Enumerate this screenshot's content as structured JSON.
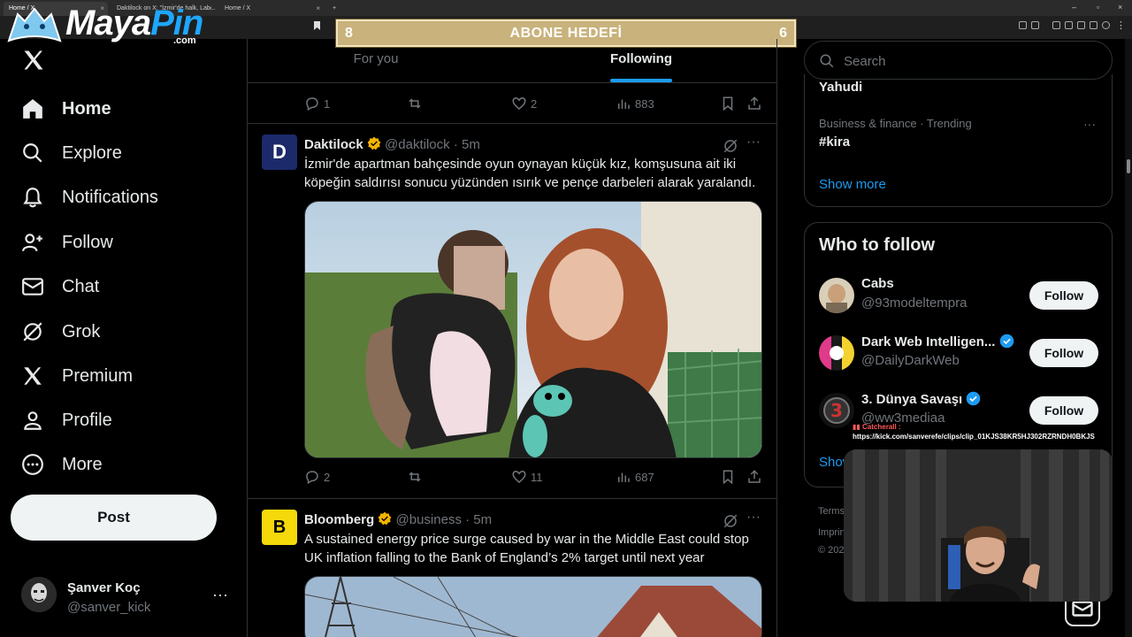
{
  "browser": {
    "tabs": [
      {
        "label": "Home / X"
      },
      {
        "label": "Daktilock on X: \"İzmir'de halk, Lab..."
      },
      {
        "label": "Home / X"
      }
    ],
    "new_tab": "+"
  },
  "overlay": {
    "banner_left": "8",
    "banner_title": "ABONE HEDEFİ",
    "banner_right": "6",
    "logo_main": "Maya",
    "logo_pin": "Pin",
    "logo_com": ".com",
    "clip_tag": "▮▮ Catcherall :",
    "clip_url": "https://kick.com/sanverefe/clips/clip_01KJS38KR5HJ302RZRNDH0BKJS"
  },
  "sidebar": {
    "items": [
      {
        "label": "Home",
        "icon": "home-icon"
      },
      {
        "label": "Explore",
        "icon": "search-icon"
      },
      {
        "label": "Notifications",
        "icon": "bell-icon"
      },
      {
        "label": "Follow",
        "icon": "person-plus-icon"
      },
      {
        "label": "Chat",
        "icon": "envelope-icon"
      },
      {
        "label": "Grok",
        "icon": "grok-icon"
      },
      {
        "label": "Premium",
        "icon": "x-icon"
      },
      {
        "label": "Profile",
        "icon": "person-icon"
      },
      {
        "label": "More",
        "icon": "more-circle-icon"
      }
    ],
    "post_label": "Post",
    "account": {
      "name": "Şanver Koç",
      "handle": "@sanver_kick",
      "more": "···"
    }
  },
  "main": {
    "tabs": {
      "for_you": "For you",
      "following": "Following"
    },
    "prev_actions": {
      "replies": "1",
      "reposts": "",
      "likes": "2",
      "views": "883"
    },
    "tweets": [
      {
        "name": "Daktilock",
        "handle": "@daktilock",
        "time": "· 5m",
        "avatar_letter": "D",
        "text": "İzmir'de apartman bahçesinde oyun oynayan küçük kız, komşusuna ait iki köpeğin saldırısı sonucu yüzünden ısırık ve pençe darbeleri alarak yaralandı.",
        "actions": {
          "replies": "2",
          "reposts": "",
          "likes": "11",
          "views": "687"
        }
      },
      {
        "name": "Bloomberg",
        "handle": "@business",
        "time": "· 5m",
        "avatar_letter": "B",
        "text": "A sustained energy price surge caused by war in the Middle East could stop UK inflation falling to the Bank of England’s 2% target until next year"
      }
    ]
  },
  "right": {
    "search_placeholder": "Search",
    "trend_prev": "Yahudi",
    "trend_category": "Business & finance · Trending",
    "trend_name": "#kira",
    "trend_more": "···",
    "show_more": "Show more",
    "who_to_follow": "Who to follow",
    "suggestions": [
      {
        "name": "Cabs",
        "handle": "@93modeltempra",
        "verified": false,
        "button": "Follow"
      },
      {
        "name": "Dark Web Intelligen...",
        "handle": "@DailyDarkWeb",
        "verified": true,
        "button": "Follow"
      },
      {
        "name": "3. Dünya Savaşı",
        "handle": "@ww3mediaa",
        "verified": true,
        "button": "Follow"
      }
    ],
    "wtf_show": "Show",
    "footer": [
      "Terms",
      "Imprint",
      "© 202"
    ]
  },
  "colors": {
    "accent": "#1d9bf0",
    "banner": "#c9b27c",
    "verified": "#f4b400",
    "background": "#000000"
  }
}
